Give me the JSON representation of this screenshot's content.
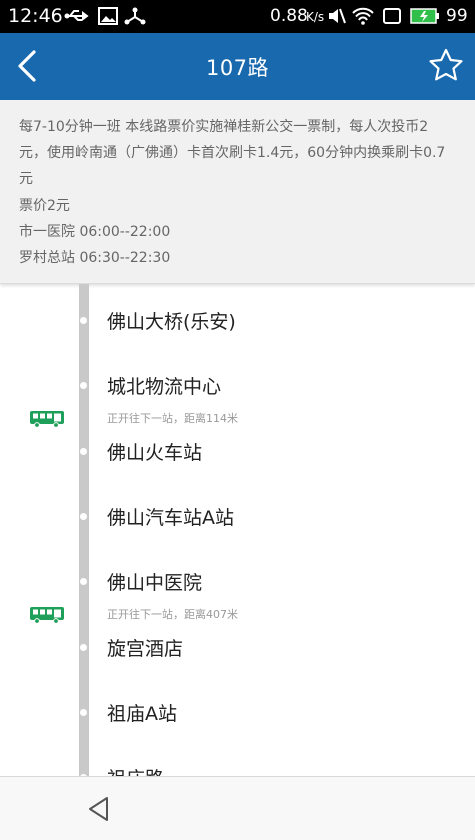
{
  "status_bar": {
    "time": "12:46",
    "data_rate": "0.88",
    "data_unit": "K/s",
    "battery": "99"
  },
  "header": {
    "title": "107路",
    "back_icon": "chevron-left-icon",
    "favorite_icon": "star-outline-icon"
  },
  "route_info": {
    "description": "每7-10分钟一班 本线路票价实施禅桂新公交一票制，每人次投币2元，使用岭南通（广佛通）卡首次刷卡1.4元，60分钟内换乘刷卡0.7元",
    "fare": "票价2元",
    "terminal_a": "市一医院 06:00--22:00",
    "terminal_b": "罗村总站 06:30--22:30"
  },
  "stops": [
    {
      "name": "佛山大桥(乐安)"
    },
    {
      "name": "城北物流中心"
    },
    {
      "name": "佛山火车站"
    },
    {
      "name": "佛山汽车站A站"
    },
    {
      "name": "佛山中医院"
    },
    {
      "name": "旋宫酒店"
    },
    {
      "name": "祖庙A站"
    },
    {
      "name": "祖庙路"
    }
  ],
  "buses": [
    {
      "hint": "正开往下一站，距离114米",
      "icon": "bus-icon"
    },
    {
      "hint": "正开往下一站，距离407米",
      "icon": "bus-icon"
    }
  ],
  "colors": {
    "app_bar": "#1869ad",
    "bus_green": "#1fa05a",
    "track": "#c9c9c9"
  }
}
